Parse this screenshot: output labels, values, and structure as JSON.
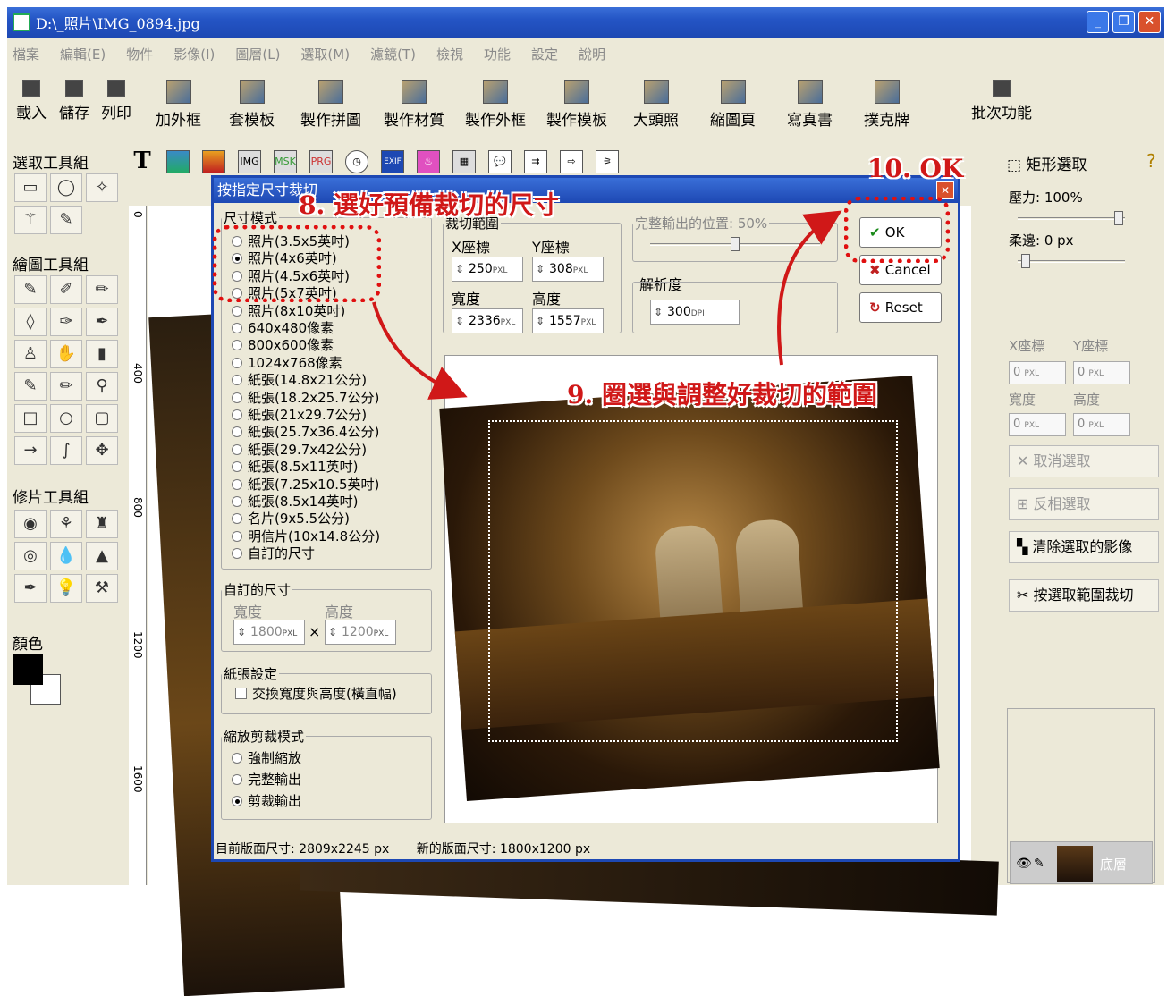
{
  "window": {
    "title": "D:\\_照片\\IMG_0894.jpg"
  },
  "menu": [
    "檔案",
    "編輯(E)",
    "物件",
    "影像(I)",
    "圖層(L)",
    "選取(M)",
    "濾鏡(T)",
    "檢視",
    "功能",
    "設定",
    "說明"
  ],
  "toolbar": [
    {
      "label": "載入",
      "icon": "open-folder-icon"
    },
    {
      "label": "儲存",
      "icon": "save-disk-icon"
    },
    {
      "label": "列印",
      "icon": "printer-icon"
    },
    {
      "label": "加外框",
      "icon": "frame-icon"
    },
    {
      "label": "套模板",
      "icon": "template-icon"
    },
    {
      "label": "製作拼圖",
      "icon": "puzzle-icon"
    },
    {
      "label": "製作材質",
      "icon": "texture-icon"
    },
    {
      "label": "製作外框",
      "icon": "make-frame-icon"
    },
    {
      "label": "製作模板",
      "icon": "make-template-icon"
    },
    {
      "label": "大頭照",
      "icon": "id-photo-icon"
    },
    {
      "label": "縮圖頁",
      "icon": "thumbnail-page-icon"
    },
    {
      "label": "寫真書",
      "icon": "photo-book-icon"
    },
    {
      "label": "撲克牌",
      "icon": "poker-card-icon"
    },
    {
      "label": "批次功能",
      "icon": "batch-icon"
    }
  ],
  "left_panel": {
    "select_tools": "選取工具組",
    "draw_tools": "繪圖工具組",
    "retouch_tools": "修片工具組",
    "color": "顏色"
  },
  "edit_icons": {
    "text": "T",
    "img": "IMG",
    "msk": "MSK",
    "prg": "PRG",
    "exif": "EXIF"
  },
  "ruler": [
    "0",
    "400",
    "800",
    "1200",
    "1600"
  ],
  "right_panel": {
    "tool_title": "矩形選取",
    "pressure": "壓力: 100%",
    "feather": "柔邊: 0 px",
    "x_label": "X座標",
    "y_label": "Y座標",
    "w_label": "寬度",
    "h_label": "高度",
    "x_val": "0",
    "y_val": "0",
    "w_val": "0",
    "h_val": "0",
    "unit": "PXL",
    "btn_cancel_select": "取消選取",
    "btn_invert": "反相選取",
    "btn_clear": "清除選取的影像",
    "btn_crop": "按選取範圍裁切",
    "layer_name": "底層"
  },
  "dialog": {
    "title": "按指定尺寸裁切",
    "size_mode_legend": "尺寸模式",
    "size_options": [
      "照片(3.5x5英吋)",
      "照片(4x6英吋)",
      "照片(4.5x6英吋)",
      "照片(5x7英吋)",
      "照片(8x10英吋)",
      "640x480像素",
      "800x600像素",
      "1024x768像素",
      "紙張(14.8x21公分)",
      "紙張(18.2x25.7公分)",
      "紙張(21x29.7公分)",
      "紙張(25.7x36.4公分)",
      "紙張(29.7x42公分)",
      "紙張(8.5x11英吋)",
      "紙張(7.25x10.5英吋)",
      "紙張(8.5x14英吋)",
      "名片(9x5.5公分)",
      "明信片(10x14.8公分)",
      "自訂的尺寸"
    ],
    "selected_size_index": 1,
    "crop_range_legend": "裁切範圍",
    "x_label": "X座標",
    "y_label": "Y座標",
    "w_label": "寬度",
    "h_label": "高度",
    "x_val": "250",
    "y_val": "308",
    "w_val": "2336",
    "h_val": "1557",
    "pxl": "PXL",
    "output_pos_legend": "完整輸出的位置: 50%",
    "output_pos": 0.5,
    "resolution_legend": "解析度",
    "resolution_val": "300",
    "dpi": "DPI",
    "custom_legend": "自訂的尺寸",
    "custom_w_label": "寬度",
    "custom_h_label": "高度",
    "custom_w": "1800",
    "custom_h": "1200",
    "times": "×",
    "paper_legend": "紙張設定",
    "swap_label": "交換寬度與高度(橫直幅)",
    "scale_legend": "縮放剪裁模式",
    "scale_options": [
      "強制縮放",
      "完整輸出",
      "剪裁輸出"
    ],
    "selected_scale_index": 2,
    "ok": "OK",
    "cancel": "Cancel",
    "reset": "Reset",
    "status_current": "目前版面尺寸: 2809x2245 px",
    "status_new": "新的版面尺寸: 1800x1200 px"
  },
  "annotations": {
    "step8": "8. 選好預備裁切的尺寸",
    "step9": "9. 圈選與調整好裁切的範圍",
    "step10": "10. OK"
  },
  "colors": {
    "title_blue": "#1d48b3",
    "annotation_red": "#d01818"
  }
}
